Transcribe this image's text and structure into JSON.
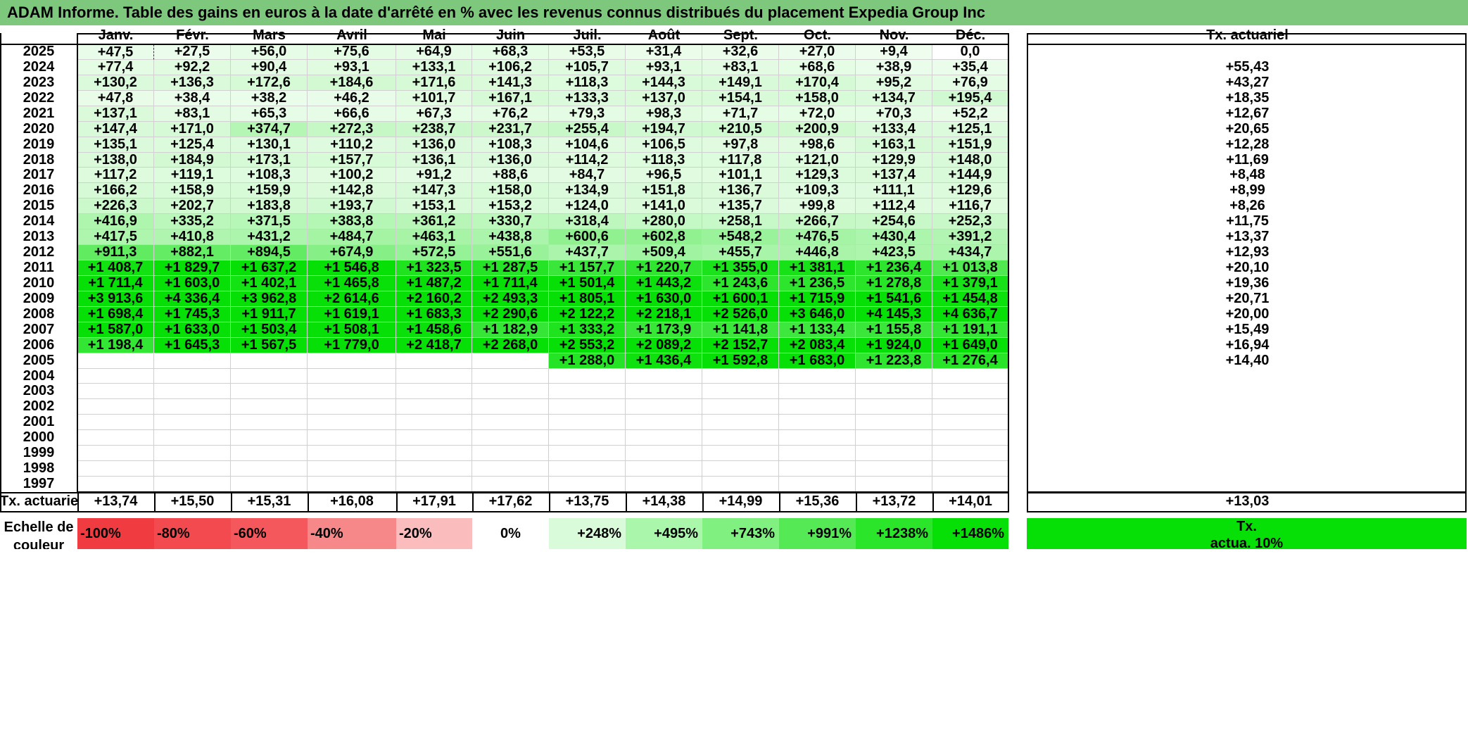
{
  "title": "ADAM Informe. Table des gains en euros à la date d'arrêté en % avec les revenus connus distribués du placement Expedia Group Inc",
  "months": [
    "Janv.",
    "Févr.",
    "Mars",
    "Avril",
    "Mai",
    "Juin",
    "Juil.",
    "Août",
    "Sept.",
    "Oct.",
    "Nov.",
    "Déc."
  ],
  "tx_header": "Tx. actuariel",
  "rows": [
    {
      "year": "2025",
      "values": [
        "+47,5",
        "+27,5",
        "+56,0",
        "+75,6",
        "+64,9",
        "+68,3",
        "+53,5",
        "+31,4",
        "+32,6",
        "+27,0",
        "+9,4",
        "0,0"
      ],
      "tx": ""
    },
    {
      "year": "2024",
      "values": [
        "+77,4",
        "+92,2",
        "+90,4",
        "+93,1",
        "+133,1",
        "+106,2",
        "+105,7",
        "+93,1",
        "+83,1",
        "+68,6",
        "+38,9",
        "+35,4"
      ],
      "tx": "+55,43"
    },
    {
      "year": "2023",
      "values": [
        "+130,2",
        "+136,3",
        "+172,6",
        "+184,6",
        "+171,6",
        "+141,3",
        "+118,3",
        "+144,3",
        "+149,1",
        "+170,4",
        "+95,2",
        "+76,9"
      ],
      "tx": "+43,27"
    },
    {
      "year": "2022",
      "values": [
        "+47,8",
        "+38,4",
        "+38,2",
        "+46,2",
        "+101,7",
        "+167,1",
        "+133,3",
        "+137,0",
        "+154,1",
        "+158,0",
        "+134,7",
        "+195,4"
      ],
      "tx": "+18,35"
    },
    {
      "year": "2021",
      "values": [
        "+137,1",
        "+83,1",
        "+65,3",
        "+66,6",
        "+67,3",
        "+76,2",
        "+79,3",
        "+98,3",
        "+71,7",
        "+72,0",
        "+70,3",
        "+52,2"
      ],
      "tx": "+12,67"
    },
    {
      "year": "2020",
      "values": [
        "+147,4",
        "+171,0",
        "+374,7",
        "+272,3",
        "+238,7",
        "+231,7",
        "+255,4",
        "+194,7",
        "+210,5",
        "+200,9",
        "+133,4",
        "+125,1"
      ],
      "tx": "+20,65"
    },
    {
      "year": "2019",
      "values": [
        "+135,1",
        "+125,4",
        "+130,1",
        "+110,2",
        "+136,0",
        "+108,3",
        "+104,6",
        "+106,5",
        "+97,8",
        "+98,6",
        "+163,1",
        "+151,9"
      ],
      "tx": "+12,28"
    },
    {
      "year": "2018",
      "values": [
        "+138,0",
        "+184,9",
        "+173,1",
        "+157,7",
        "+136,1",
        "+136,0",
        "+114,2",
        "+118,3",
        "+117,8",
        "+121,0",
        "+129,9",
        "+148,0"
      ],
      "tx": "+11,69"
    },
    {
      "year": "2017",
      "values": [
        "+117,2",
        "+119,1",
        "+108,3",
        "+100,2",
        "+91,2",
        "+88,6",
        "+84,7",
        "+96,5",
        "+101,1",
        "+129,3",
        "+137,4",
        "+144,9"
      ],
      "tx": "+8,48"
    },
    {
      "year": "2016",
      "values": [
        "+166,2",
        "+158,9",
        "+159,9",
        "+142,8",
        "+147,3",
        "+158,0",
        "+134,9",
        "+151,8",
        "+136,7",
        "+109,3",
        "+111,1",
        "+129,6"
      ],
      "tx": "+8,99"
    },
    {
      "year": "2015",
      "values": [
        "+226,3",
        "+202,7",
        "+183,8",
        "+193,7",
        "+153,1",
        "+153,2",
        "+124,0",
        "+141,0",
        "+135,7",
        "+99,8",
        "+112,4",
        "+116,7"
      ],
      "tx": "+8,26"
    },
    {
      "year": "2014",
      "values": [
        "+416,9",
        "+335,2",
        "+371,5",
        "+383,8",
        "+361,2",
        "+330,7",
        "+318,4",
        "+280,0",
        "+258,1",
        "+266,7",
        "+254,6",
        "+252,3"
      ],
      "tx": "+11,75"
    },
    {
      "year": "2013",
      "values": [
        "+417,5",
        "+410,8",
        "+431,2",
        "+484,7",
        "+463,1",
        "+438,8",
        "+600,6",
        "+602,8",
        "+548,2",
        "+476,5",
        "+430,4",
        "+391,2"
      ],
      "tx": "+13,37"
    },
    {
      "year": "2012",
      "values": [
        "+911,3",
        "+882,1",
        "+894,5",
        "+674,9",
        "+572,5",
        "+551,6",
        "+437,7",
        "+509,4",
        "+455,7",
        "+446,8",
        "+423,5",
        "+434,7"
      ],
      "tx": "+12,93"
    },
    {
      "year": "2011",
      "values": [
        "+1 408,7",
        "+1 829,7",
        "+1 637,2",
        "+1 546,8",
        "+1 323,5",
        "+1 287,5",
        "+1 157,7",
        "+1 220,7",
        "+1 355,0",
        "+1 381,1",
        "+1 236,4",
        "+1 013,8"
      ],
      "tx": "+20,10"
    },
    {
      "year": "2010",
      "values": [
        "+1 711,4",
        "+1 603,0",
        "+1 402,1",
        "+1 465,8",
        "+1 487,2",
        "+1 711,4",
        "+1 501,4",
        "+1 443,2",
        "+1 243,6",
        "+1 236,5",
        "+1 278,8",
        "+1 379,1"
      ],
      "tx": "+19,36"
    },
    {
      "year": "2009",
      "values": [
        "+3 913,6",
        "+4 336,4",
        "+3 962,8",
        "+2 614,6",
        "+2 160,2",
        "+2 493,3",
        "+1 805,1",
        "+1 630,0",
        "+1 600,1",
        "+1 715,9",
        "+1 541,6",
        "+1 454,8"
      ],
      "tx": "+20,71"
    },
    {
      "year": "2008",
      "values": [
        "+1 698,4",
        "+1 745,3",
        "+1 911,7",
        "+1 619,1",
        "+1 683,3",
        "+2 290,6",
        "+2 122,2",
        "+2 218,1",
        "+2 526,0",
        "+3 646,0",
        "+4 145,3",
        "+4 636,7"
      ],
      "tx": "+20,00"
    },
    {
      "year": "2007",
      "values": [
        "+1 587,0",
        "+1 633,0",
        "+1 503,4",
        "+1 508,1",
        "+1 458,6",
        "+1 182,9",
        "+1 333,2",
        "+1 173,9",
        "+1 141,8",
        "+1 133,4",
        "+1 155,8",
        "+1 191,1"
      ],
      "tx": "+15,49"
    },
    {
      "year": "2006",
      "values": [
        "+1 198,4",
        "+1 645,3",
        "+1 567,5",
        "+1 779,0",
        "+2 418,7",
        "+2 268,0",
        "+2 553,2",
        "+2 089,2",
        "+2 152,7",
        "+2 083,4",
        "+1 924,0",
        "+1 649,0"
      ],
      "tx": "+16,94"
    },
    {
      "year": "2005",
      "values": [
        "",
        "",
        "",
        "",
        "",
        "",
        "+1 288,0",
        "+1 436,4",
        "+1 592,8",
        "+1 683,0",
        "+1 223,8",
        "+1 276,4"
      ],
      "tx": "+14,40"
    },
    {
      "year": "2004",
      "values": [
        "",
        "",
        "",
        "",
        "",
        "",
        "",
        "",
        "",
        "",
        "",
        ""
      ],
      "tx": ""
    },
    {
      "year": "2003",
      "values": [
        "",
        "",
        "",
        "",
        "",
        "",
        "",
        "",
        "",
        "",
        "",
        ""
      ],
      "tx": ""
    },
    {
      "year": "2002",
      "values": [
        "",
        "",
        "",
        "",
        "",
        "",
        "",
        "",
        "",
        "",
        "",
        ""
      ],
      "tx": ""
    },
    {
      "year": "2001",
      "values": [
        "",
        "",
        "",
        "",
        "",
        "",
        "",
        "",
        "",
        "",
        "",
        ""
      ],
      "tx": ""
    },
    {
      "year": "2000",
      "values": [
        "",
        "",
        "",
        "",
        "",
        "",
        "",
        "",
        "",
        "",
        "",
        ""
      ],
      "tx": ""
    },
    {
      "year": "1999",
      "values": [
        "",
        "",
        "",
        "",
        "",
        "",
        "",
        "",
        "",
        "",
        "",
        ""
      ],
      "tx": ""
    },
    {
      "year": "1998",
      "values": [
        "",
        "",
        "",
        "",
        "",
        "",
        "",
        "",
        "",
        "",
        "",
        ""
      ],
      "tx": ""
    },
    {
      "year": "1997",
      "values": [
        "",
        "",
        "",
        "",
        "",
        "",
        "",
        "",
        "",
        "",
        "",
        ""
      ],
      "tx": ""
    }
  ],
  "footer": {
    "label": "Tx. actuariel",
    "values": [
      "+13,74",
      "+15,50",
      "+15,31",
      "+16,08",
      "+17,91",
      "+17,62",
      "+13,75",
      "+14,38",
      "+14,99",
      "+15,36",
      "+13,72",
      "+14,01"
    ],
    "total": "+13,03"
  },
  "legend": {
    "title_line1": "Echelle de",
    "title_line2": "couleur",
    "items": [
      {
        "label": "-100%",
        "color": "#f03c40",
        "align": "left"
      },
      {
        "label": "-80%",
        "color": "#f24a4e",
        "align": "left"
      },
      {
        "label": "-60%",
        "color": "#f4585c",
        "align": "left"
      },
      {
        "label": "-40%",
        "color": "#f7888a",
        "align": "left"
      },
      {
        "label": "-20%",
        "color": "#fbbcbd",
        "align": "left"
      },
      {
        "label": "0%",
        "color": "#ffffff",
        "align": "center"
      },
      {
        "label": "+248%",
        "color": "#d9fbd9",
        "align": "right"
      },
      {
        "label": "+495%",
        "color": "#aaf6aa",
        "align": "right"
      },
      {
        "label": "+743%",
        "color": "#80f080",
        "align": "right"
      },
      {
        "label": "+991%",
        "color": "#55ea55",
        "align": "right"
      },
      {
        "label": "+1238%",
        "color": "#2ae52a",
        "align": "right"
      },
      {
        "label": "+1486%",
        "color": "#06e006",
        "align": "right"
      }
    ],
    "tx_line1": "Tx.",
    "tx_line2": "actua. 10%",
    "tx_color": "#06e006"
  },
  "colors": {
    "title_bg": "#7ec87e",
    "scale_max": 1486
  }
}
